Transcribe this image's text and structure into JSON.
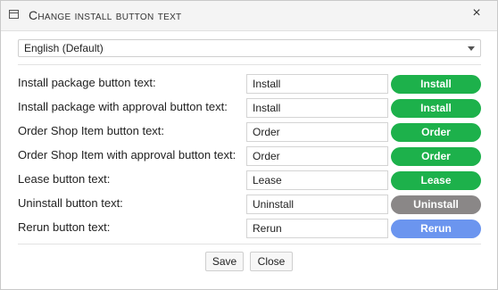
{
  "dialog": {
    "title": "Change install button text",
    "close_symbol": "×",
    "window_icon": "window-icon",
    "close_icon": "close-icon"
  },
  "language_select": {
    "value": "English (Default)"
  },
  "rows": [
    {
      "label": "Install package button text:",
      "value": "Install",
      "preview": "Install",
      "preview_color": "#1db14b"
    },
    {
      "label": "Install package with approval button text:",
      "value": "Install",
      "preview": "Install",
      "preview_color": "#1db14b"
    },
    {
      "label": "Order Shop Item button text:",
      "value": "Order",
      "preview": "Order",
      "preview_color": "#1db14b"
    },
    {
      "label": "Order Shop Item with approval button text:",
      "value": "Order",
      "preview": "Order",
      "preview_color": "#1db14b"
    },
    {
      "label": "Lease button text:",
      "value": "Lease",
      "preview": "Lease",
      "preview_color": "#1db14b"
    },
    {
      "label": "Uninstall button text:",
      "value": "Uninstall",
      "preview": "Uninstall",
      "preview_color": "#8a8787"
    },
    {
      "label": "Rerun button text:",
      "value": "Rerun",
      "preview": "Rerun",
      "preview_color": "#6b95ef"
    }
  ],
  "footer": {
    "save_label": "Save",
    "close_label": "Close"
  }
}
